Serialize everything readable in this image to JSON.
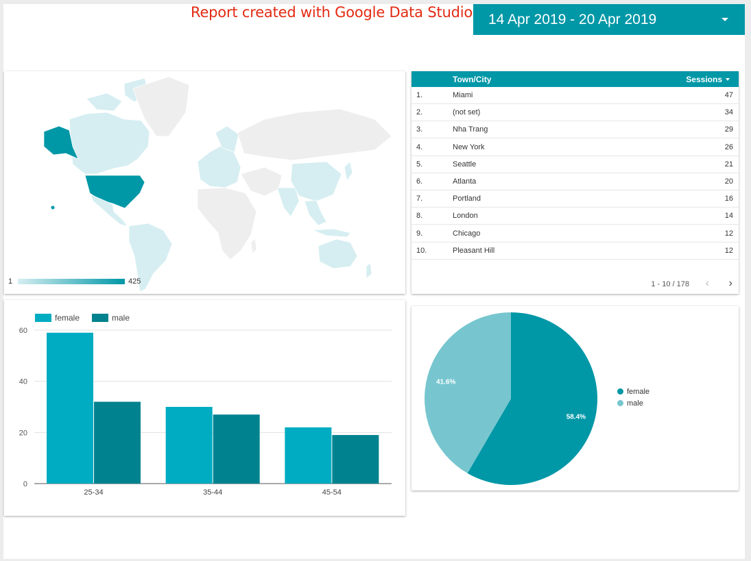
{
  "header": {
    "report_note": "Report created with Google Data Studio",
    "date_range": "14 Apr 2019 - 20 Apr 2019"
  },
  "map": {
    "legend_min": "1",
    "legend_max": "425",
    "colors": {
      "low": "#d6eef1",
      "high": "#0097a7",
      "no_data": "#eeeeee"
    }
  },
  "table": {
    "headers": {
      "city": "Town/City",
      "sessions": "Sessions"
    },
    "rows": [
      {
        "num": "1.",
        "city": "Miami",
        "sessions": "47"
      },
      {
        "num": "2.",
        "city": "(not set)",
        "sessions": "34"
      },
      {
        "num": "3.",
        "city": "Nha Trang",
        "sessions": "29"
      },
      {
        "num": "4.",
        "city": "New York",
        "sessions": "26"
      },
      {
        "num": "5.",
        "city": "Seattle",
        "sessions": "21"
      },
      {
        "num": "6.",
        "city": "Atlanta",
        "sessions": "20"
      },
      {
        "num": "7.",
        "city": "Portland",
        "sessions": "16"
      },
      {
        "num": "8.",
        "city": "London",
        "sessions": "14"
      },
      {
        "num": "9.",
        "city": "Chicago",
        "sessions": "12"
      },
      {
        "num": "10.",
        "city": "Pleasant Hill",
        "sessions": "12"
      }
    ],
    "pagination": "1 - 10 / 178",
    "prev_icon": "‹",
    "next_icon": "›"
  },
  "chart_data": [
    {
      "type": "bar",
      "categories": [
        "25-34",
        "35-44",
        "45-54"
      ],
      "series": [
        {
          "name": "female",
          "values": [
            59,
            30,
            22
          ],
          "color": "#00acc1"
        },
        {
          "name": "male",
          "values": [
            32,
            27,
            19
          ],
          "color": "#00838f"
        }
      ],
      "ylim": [
        0,
        60
      ],
      "yticks": [
        0,
        20,
        40,
        60
      ],
      "legend": "top-left",
      "grid": true
    },
    {
      "type": "pie",
      "slices": [
        {
          "name": "female",
          "value": 58.4,
          "label": "58.4%",
          "color": "#0097a7"
        },
        {
          "name": "male",
          "value": 41.6,
          "label": "41.6%",
          "color": "#77c6cf"
        }
      ],
      "legend": "right"
    }
  ]
}
